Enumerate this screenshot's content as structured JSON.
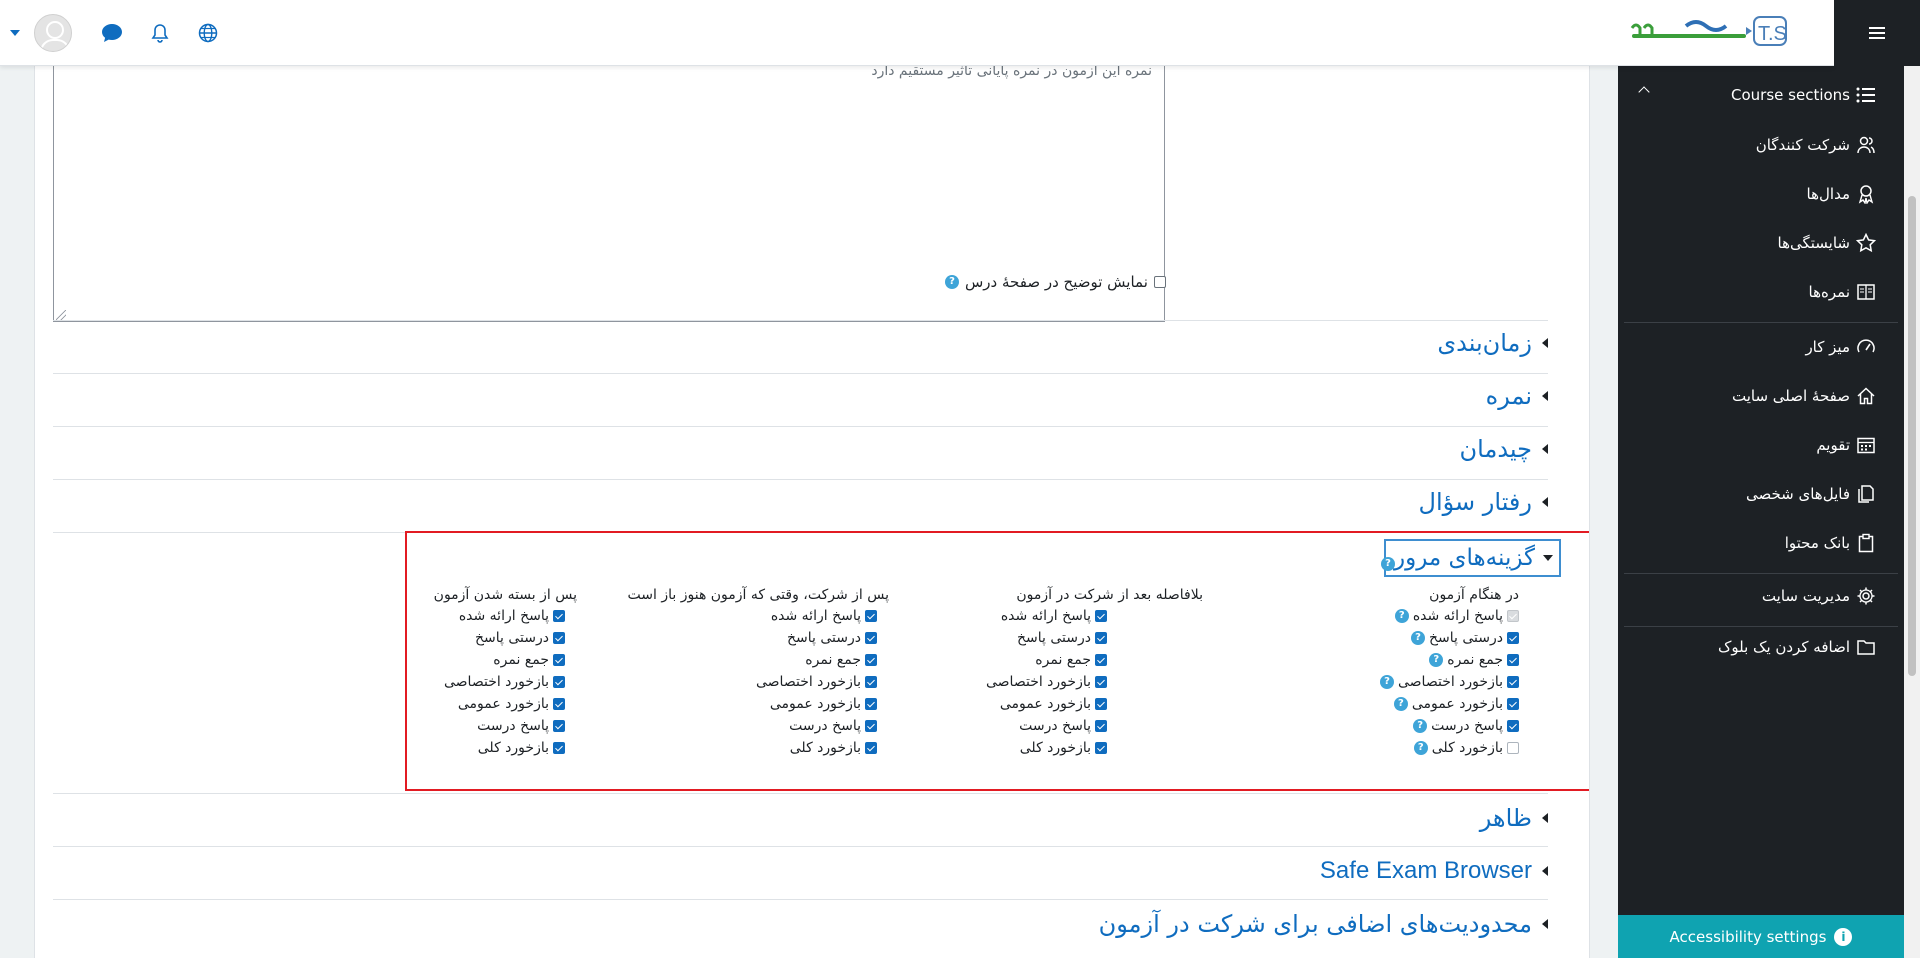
{
  "navbar": {
    "logo_text": "T.S تهران۲۰۲",
    "icons": [
      "globe-icon",
      "bell-icon",
      "chat-icon"
    ]
  },
  "drawer": {
    "section_header": "Course sections",
    "items_top": [
      {
        "label": "شرکت کنندگان",
        "icon": "participants-icon"
      },
      {
        "label": "مدال‌ها",
        "icon": "badge-icon"
      },
      {
        "label": "شایستگی‌ها",
        "icon": "star-icon"
      },
      {
        "label": "نمره‌ها",
        "icon": "grades-icon"
      }
    ],
    "items_main": [
      {
        "label": "میز کار",
        "icon": "dashboard-icon"
      },
      {
        "label": "صفحهٔ اصلی سایت",
        "icon": "home-icon"
      },
      {
        "label": "تقویم",
        "icon": "calendar-icon"
      },
      {
        "label": "فایل‌های شخصی",
        "icon": "files-icon"
      },
      {
        "label": "بانک محتوا",
        "icon": "clipboard-icon"
      }
    ],
    "site_admin": {
      "label": "مدیریت سایت",
      "icon": "gear-icon"
    },
    "add_block": {
      "label": "اضافه کردن یک بلوک",
      "icon": "folder-icon"
    },
    "accessibility": "Accessibility settings"
  },
  "form": {
    "editor_text": "نمره این آزمون در نمره پایانی تأثیر مستقیم دارد",
    "show_description": "نمایش توضیح در صفحهٔ درس",
    "sections": {
      "timing": "زمان‌بندی",
      "grade": "نمره",
      "layout": "چیدمان",
      "question_behaviour": "رفتار سؤال",
      "review_options": "گزینه‌های مرور",
      "appearance": "ظاهر",
      "safe_exam": "Safe Exam Browser",
      "extra_restrictions": "محدودیت‌های اضافی برای شرکت در آزمون"
    },
    "review_columns": [
      {
        "title": "در هنگام آزمون",
        "options": [
          {
            "label": "پاسخ ارائه شده",
            "state": "disabled-checked",
            "help": true
          },
          {
            "label": "درستی پاسخ",
            "state": "checked",
            "help": true
          },
          {
            "label": "جمع نمره",
            "state": "checked",
            "help": true
          },
          {
            "label": "بازخورد اختصاصی",
            "state": "checked",
            "help": true
          },
          {
            "label": "بازخورد عمومی",
            "state": "checked",
            "help": true
          },
          {
            "label": "پاسخ درست",
            "state": "checked",
            "help": true
          },
          {
            "label": "بازخورد کلی",
            "state": "disabled",
            "help": true
          }
        ]
      },
      {
        "title": "بلافاصله بعد از شرکت در آزمون",
        "options": [
          {
            "label": "پاسخ ارائه شده",
            "state": "checked"
          },
          {
            "label": "درستی پاسخ",
            "state": "checked"
          },
          {
            "label": "جمع نمره",
            "state": "checked"
          },
          {
            "label": "بازخورد اختصاصی",
            "state": "checked"
          },
          {
            "label": "بازخورد عمومی",
            "state": "checked"
          },
          {
            "label": "پاسخ درست",
            "state": "checked"
          },
          {
            "label": "بازخورد کلی",
            "state": "checked"
          }
        ]
      },
      {
        "title": "پس از شرکت، وقتی که آزمون هنوز باز است",
        "options": [
          {
            "label": "پاسخ ارائه شده",
            "state": "checked"
          },
          {
            "label": "درستی پاسخ",
            "state": "checked"
          },
          {
            "label": "جمع نمره",
            "state": "checked"
          },
          {
            "label": "بازخورد اختصاصی",
            "state": "checked"
          },
          {
            "label": "بازخورد عمومی",
            "state": "checked"
          },
          {
            "label": "پاسخ درست",
            "state": "checked"
          },
          {
            "label": "بازخورد کلی",
            "state": "checked"
          }
        ]
      },
      {
        "title": "پس از بسته شدن آزمون",
        "options": [
          {
            "label": "پاسخ ارائه شده",
            "state": "checked"
          },
          {
            "label": "درستی پاسخ",
            "state": "checked"
          },
          {
            "label": "جمع نمره",
            "state": "checked"
          },
          {
            "label": "بازخورد اختصاصی",
            "state": "checked"
          },
          {
            "label": "بازخورد عمومی",
            "state": "checked"
          },
          {
            "label": "پاسخ درست",
            "state": "checked"
          },
          {
            "label": "بازخورد کلی",
            "state": "checked"
          }
        ]
      }
    ]
  },
  "colors": {
    "accent": "#0f6cbf",
    "drawer_bg": "#1d2125",
    "highlight_border": "#e21b23",
    "a11y_bg": "#0fa3b1"
  }
}
